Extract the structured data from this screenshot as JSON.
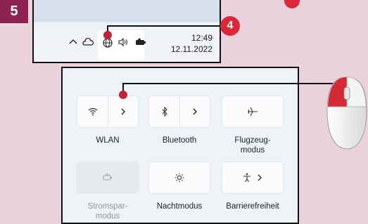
{
  "step_badge": "5",
  "callout_number": "4",
  "taskbar": {
    "icons": {
      "chevron": "chevron-up-icon",
      "cloud": "onedrive-cloud-icon",
      "network": "globe-network-icon",
      "volume": "speaker-icon",
      "battery": "battery-icon"
    },
    "time": "12:49",
    "date": "12.11.2022"
  },
  "quick_settings": {
    "tiles": [
      {
        "id": "wlan",
        "label": "WLAN",
        "icon": "wifi-icon",
        "has_arrow": true,
        "active": true
      },
      {
        "id": "bluetooth",
        "label": "Bluetooth",
        "icon": "bluetooth-icon",
        "has_arrow": true,
        "active": true
      },
      {
        "id": "flugzeug",
        "label_line1": "Flugzeug-",
        "label_line2": "modus",
        "icon": "airplane-icon",
        "active": true
      },
      {
        "id": "stromspar",
        "label_line1": "Stromspar-",
        "label_line2": "modus",
        "icon": "battery-saver-icon",
        "active": false
      },
      {
        "id": "nacht",
        "label": "Nachtmodus",
        "icon": "brightness-icon",
        "active": true
      },
      {
        "id": "barriere",
        "label": "Barrierefreiheit",
        "icon": "accessibility-icon",
        "has_arrow": true,
        "active": true
      }
    ]
  },
  "colors": {
    "background": "#e9d2dc",
    "badge": "#8b2252",
    "callout": "#d8283a"
  }
}
